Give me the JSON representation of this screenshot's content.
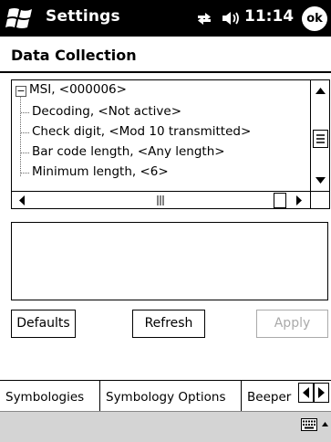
{
  "titlebar": {
    "app_title": "Settings",
    "time": "11:14",
    "ok_label": "ok"
  },
  "page": {
    "title": "Data Collection"
  },
  "tree": {
    "root": "MSI, <000006>",
    "items": [
      "Decoding, <Not active>",
      "Check digit, <Mod 10 transmitted>",
      "Bar code length, <Any length>",
      "Minimum length, <6>"
    ]
  },
  "buttons": {
    "defaults_label": "Defaults",
    "refresh_label": "Refresh",
    "apply_label": "Apply"
  },
  "tabs": [
    "Symbologies",
    "Symbology Options",
    "Beeper"
  ],
  "colors": {
    "titlebar_bg": "#000000",
    "menubar_bg": "#d4d4d4",
    "disabled_text": "#aaaaaa"
  }
}
